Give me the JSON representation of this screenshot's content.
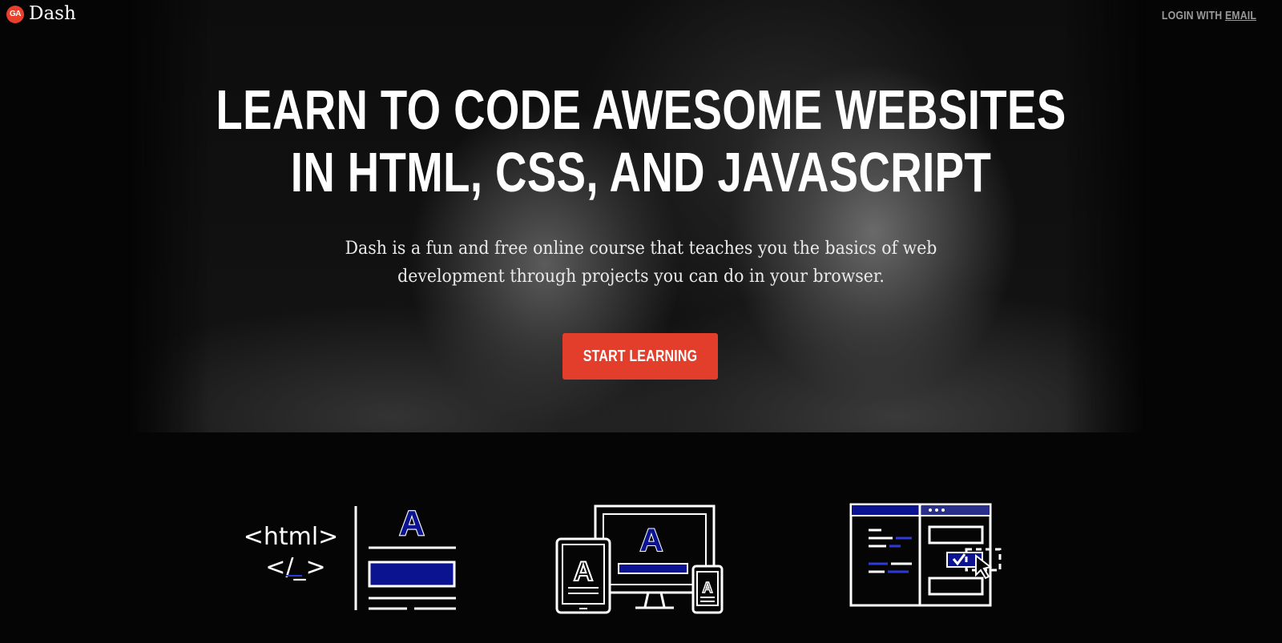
{
  "header": {
    "logo_badge": "GA",
    "brand": "Dash",
    "login_prefix": "LOGIN WITH ",
    "login_link": "EMAIL"
  },
  "hero": {
    "title_line1": "LEARN TO CODE AWESOME WEBSITES",
    "title_line2": "IN HTML, CSS, AND JAVASCRIPT",
    "subtitle_line1": "Dash is a fun and free online course that teaches you the basics of web",
    "subtitle_line2": "development through projects you can do in your browser.",
    "cta_label": "START LEARNING"
  },
  "features": {
    "html_icon": {
      "line1": "<html>",
      "line2": "</_>",
      "letter": "A"
    },
    "responsive_icon": {
      "letter": "A"
    },
    "interactive_icon": {}
  },
  "colors": {
    "accent": "#e23e2b",
    "icon_blue": "#0b1390",
    "background": "#050505",
    "text": "#ffffff"
  }
}
